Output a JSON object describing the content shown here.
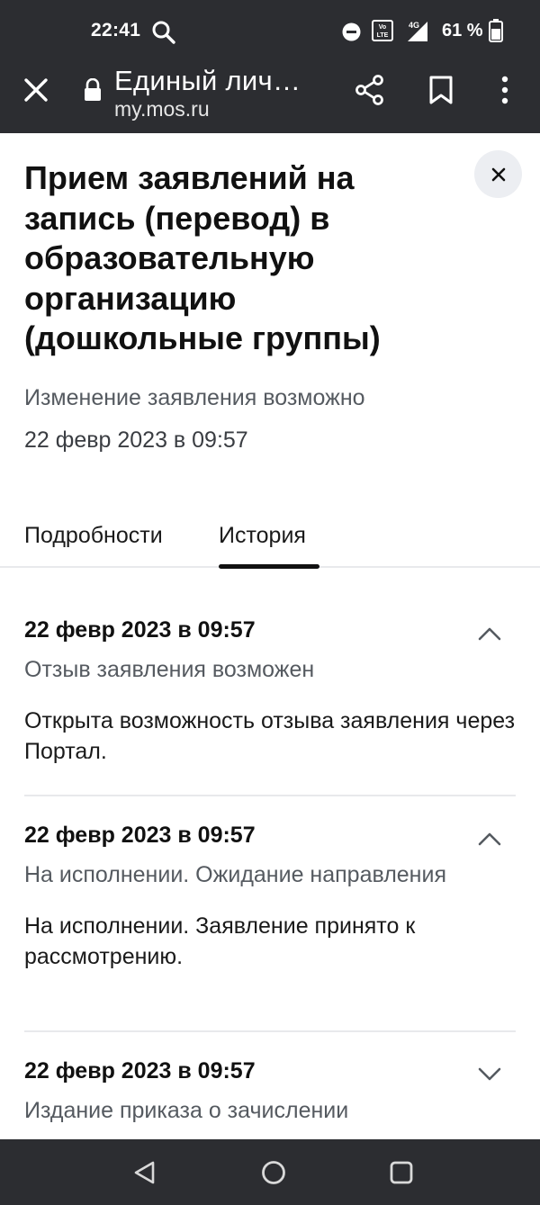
{
  "status_bar": {
    "time": "22:41",
    "battery_percent": "61 %",
    "network": "4G",
    "icons": [
      "search-icon",
      "do-not-disturb-icon",
      "volte-icon",
      "signal-icon",
      "battery-icon"
    ]
  },
  "browser": {
    "page_title": "Единый лич…",
    "url": "my.mos.ru",
    "icons": [
      "close-icon",
      "lock-icon",
      "share-icon",
      "bookmark-icon",
      "more-vert-icon"
    ]
  },
  "page": {
    "title": "Прием заявлений на запись (перевод) в образовательную организацию (дошкольные группы)",
    "state": "Изменение заявления возможно",
    "state_date": "22 февр 2023 в 09:57",
    "tabs": [
      {
        "label": "Подробности",
        "active": false
      },
      {
        "label": "История",
        "active": true
      }
    ]
  },
  "history": [
    {
      "date": "22 февр 2023 в 09:57",
      "status": "Отзыв заявления возможен",
      "description": "Открыта возможность отзыва заявления через Портал.",
      "expanded": true
    },
    {
      "date": "22 февр 2023 в 09:57",
      "status": "На исполнении. Ожидание направления",
      "description": "На исполнении. Заявление принято к рассмотрению.",
      "expanded": true
    },
    {
      "date": "22 февр 2023 в 09:57",
      "status": "Издание приказа о зачислении",
      "expanded": false
    }
  ],
  "colors": {
    "bars": "#2c2d31",
    "muted_text": "#555a60",
    "divider": "#e8e9ec",
    "close_bg": "#eceef2"
  }
}
